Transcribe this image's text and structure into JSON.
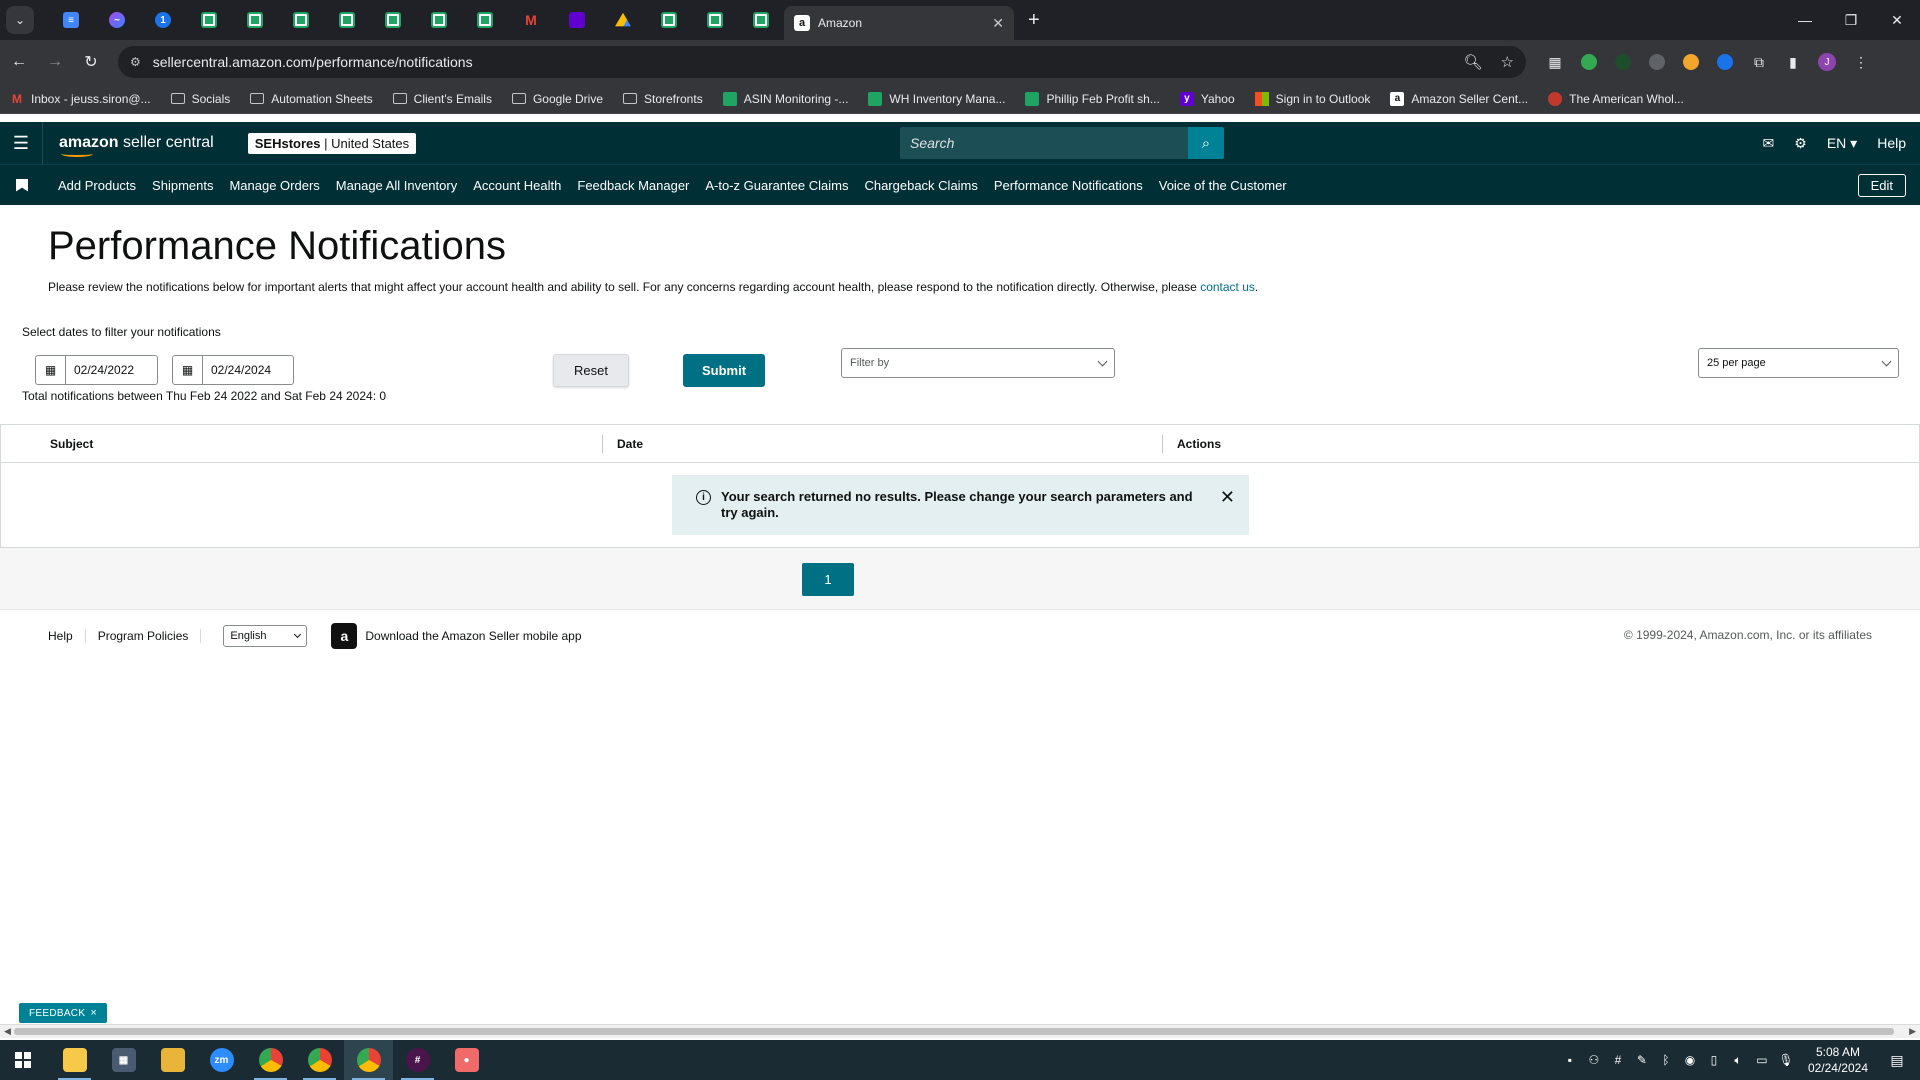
{
  "browser": {
    "menu_icon": "chevron-down-icon",
    "active_tab": {
      "title": "Amazon",
      "favicon": "a"
    },
    "new_tab_label": "+",
    "url": "sellercentral.amazon.com/performance/notifications",
    "bookmarks": [
      {
        "label": "Inbox - jeuss.siron@...",
        "icon": "gmail"
      },
      {
        "label": "Socials",
        "icon": "folder"
      },
      {
        "label": "Automation Sheets",
        "icon": "folder"
      },
      {
        "label": "Client's Emails",
        "icon": "folder"
      },
      {
        "label": "Google Drive",
        "icon": "folder"
      },
      {
        "label": "Storefronts",
        "icon": "folder"
      },
      {
        "label": "ASIN Monitoring -...",
        "icon": "sheets"
      },
      {
        "label": "WH Inventory Mana...",
        "icon": "sheets"
      },
      {
        "label": "Phillip Feb Profit sh...",
        "icon": "sheets"
      },
      {
        "label": "Yahoo",
        "icon": "yahoo"
      },
      {
        "label": "Sign in to Outlook",
        "icon": "microsoft"
      },
      {
        "label": "Amazon Seller Cent...",
        "icon": "amazon"
      },
      {
        "label": "The American Whol...",
        "icon": "american-wholesale"
      }
    ],
    "profile_initial": "J"
  },
  "header": {
    "logo_bold": "amazon",
    "logo_rest": " seller central",
    "store_name": "SEHstores",
    "store_sep": " | ",
    "store_region": "United States",
    "search_placeholder": "Search",
    "language": "EN",
    "help": "Help"
  },
  "nav": {
    "items": [
      "Add Products",
      "Shipments",
      "Manage Orders",
      "Manage All Inventory",
      "Account Health",
      "Feedback Manager",
      "A-to-z Guarantee Claims",
      "Chargeback Claims",
      "Performance Notifications",
      "Voice of the Customer"
    ],
    "edit": "Edit"
  },
  "page": {
    "title": "Performance Notifications",
    "intro": "Please review the notifications below for important alerts that might affect your account health and ability to sell. For any concerns regarding account health, please respond to the notification directly. Otherwise, please ",
    "intro_link": "contact us",
    "intro_end": ".",
    "filter_label": "Select dates to filter your notifications",
    "start_date": "02/24/2022",
    "end_date": "02/24/2024",
    "total_text": "Total notifications between Thu Feb 24 2022 and Sat Feb 24 2024: 0",
    "reset": "Reset",
    "submit": "Submit",
    "filter_placeholder": "Filter by",
    "per_page": "25 per page"
  },
  "table": {
    "columns": [
      "Subject",
      "Date",
      "Actions"
    ],
    "alert": "Your search returned no results. Please change your search parameters and try again."
  },
  "pagination": {
    "current": "1"
  },
  "footer": {
    "help": "Help",
    "policies": "Program Policies",
    "language": "English",
    "app_text": "Download the Amazon Seller mobile app",
    "copyright": "© 1999-2024, Amazon.com, Inc. or its affiliates"
  },
  "feedback": {
    "label": "FEEDBACK",
    "close": "×"
  },
  "taskbar": {
    "time": "5:08 AM",
    "date": "02/24/2024",
    "zoom_label": "zm"
  },
  "colors": {
    "header_bg": "#002f36",
    "accent": "#007185",
    "search_btn": "#008296",
    "alert_bg": "#e3eff1"
  }
}
